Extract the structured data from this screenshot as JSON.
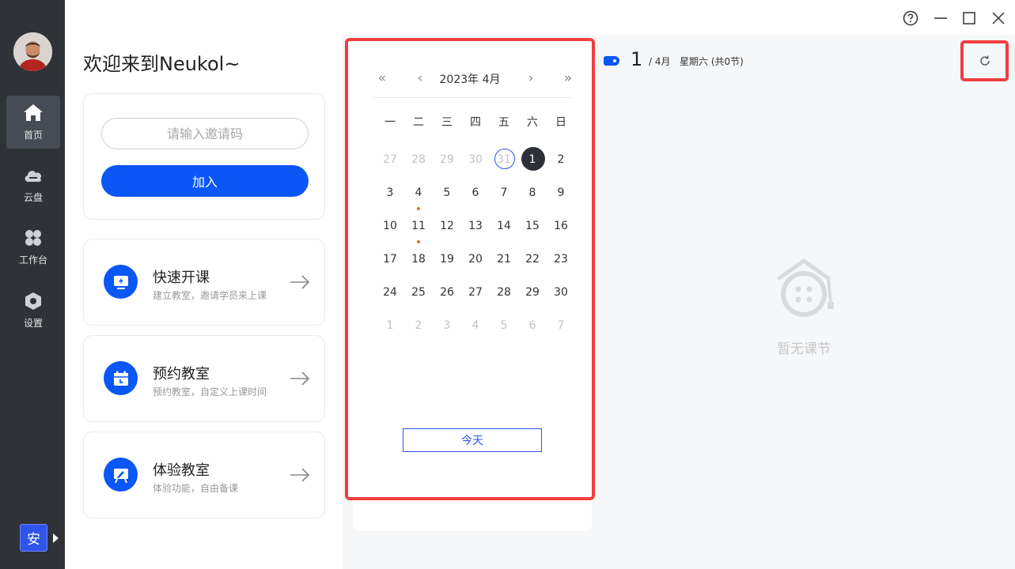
{
  "sidebar": {
    "items": [
      {
        "label": "首页",
        "icon": "home-icon",
        "active": true
      },
      {
        "label": "云盘",
        "icon": "cloud-icon",
        "active": false
      },
      {
        "label": "工作台",
        "icon": "workbench-icon",
        "active": false
      },
      {
        "label": "设置",
        "icon": "settings-icon",
        "active": false
      }
    ],
    "lang_label": "安"
  },
  "welcome": "欢迎来到Neukol~",
  "invite": {
    "placeholder": "请输入邀请码",
    "value": "",
    "join_label": "加入"
  },
  "features": [
    {
      "title": "快速开课",
      "subtitle": "建立教室，邀请学员来上课",
      "icon": "quick-class-icon"
    },
    {
      "title": "预约教室",
      "subtitle": "预约教室，自定义上课时间",
      "icon": "calendar-icon"
    },
    {
      "title": "体验教室",
      "subtitle": "体验功能，自由备课",
      "icon": "whiteboard-icon"
    }
  ],
  "calendar": {
    "title": "2023年 4月",
    "weekdays": [
      "一",
      "二",
      "三",
      "四",
      "五",
      "六",
      "日"
    ],
    "weeks": [
      [
        "27",
        "28",
        "29",
        "30",
        "31",
        "1",
        "2"
      ],
      [
        "3",
        "4",
        "5",
        "6",
        "7",
        "8",
        "9"
      ],
      [
        "10",
        "11",
        "12",
        "13",
        "14",
        "15",
        "16"
      ],
      [
        "17",
        "18",
        "19",
        "20",
        "21",
        "22",
        "23"
      ],
      [
        "24",
        "25",
        "26",
        "27",
        "28",
        "29",
        "30"
      ],
      [
        "1",
        "2",
        "3",
        "4",
        "5",
        "6",
        "7"
      ]
    ],
    "today_label": "今天"
  },
  "schedule": {
    "day": "1",
    "month": "/ 4月",
    "weekday": "星期六 (共0节)",
    "empty_text": "暂无课节"
  },
  "colors": {
    "accent": "#0a57f5",
    "sidebar_bg": "#2f3237",
    "highlight_border": "#ef3f3f",
    "event_dot": "#f06a1e"
  }
}
